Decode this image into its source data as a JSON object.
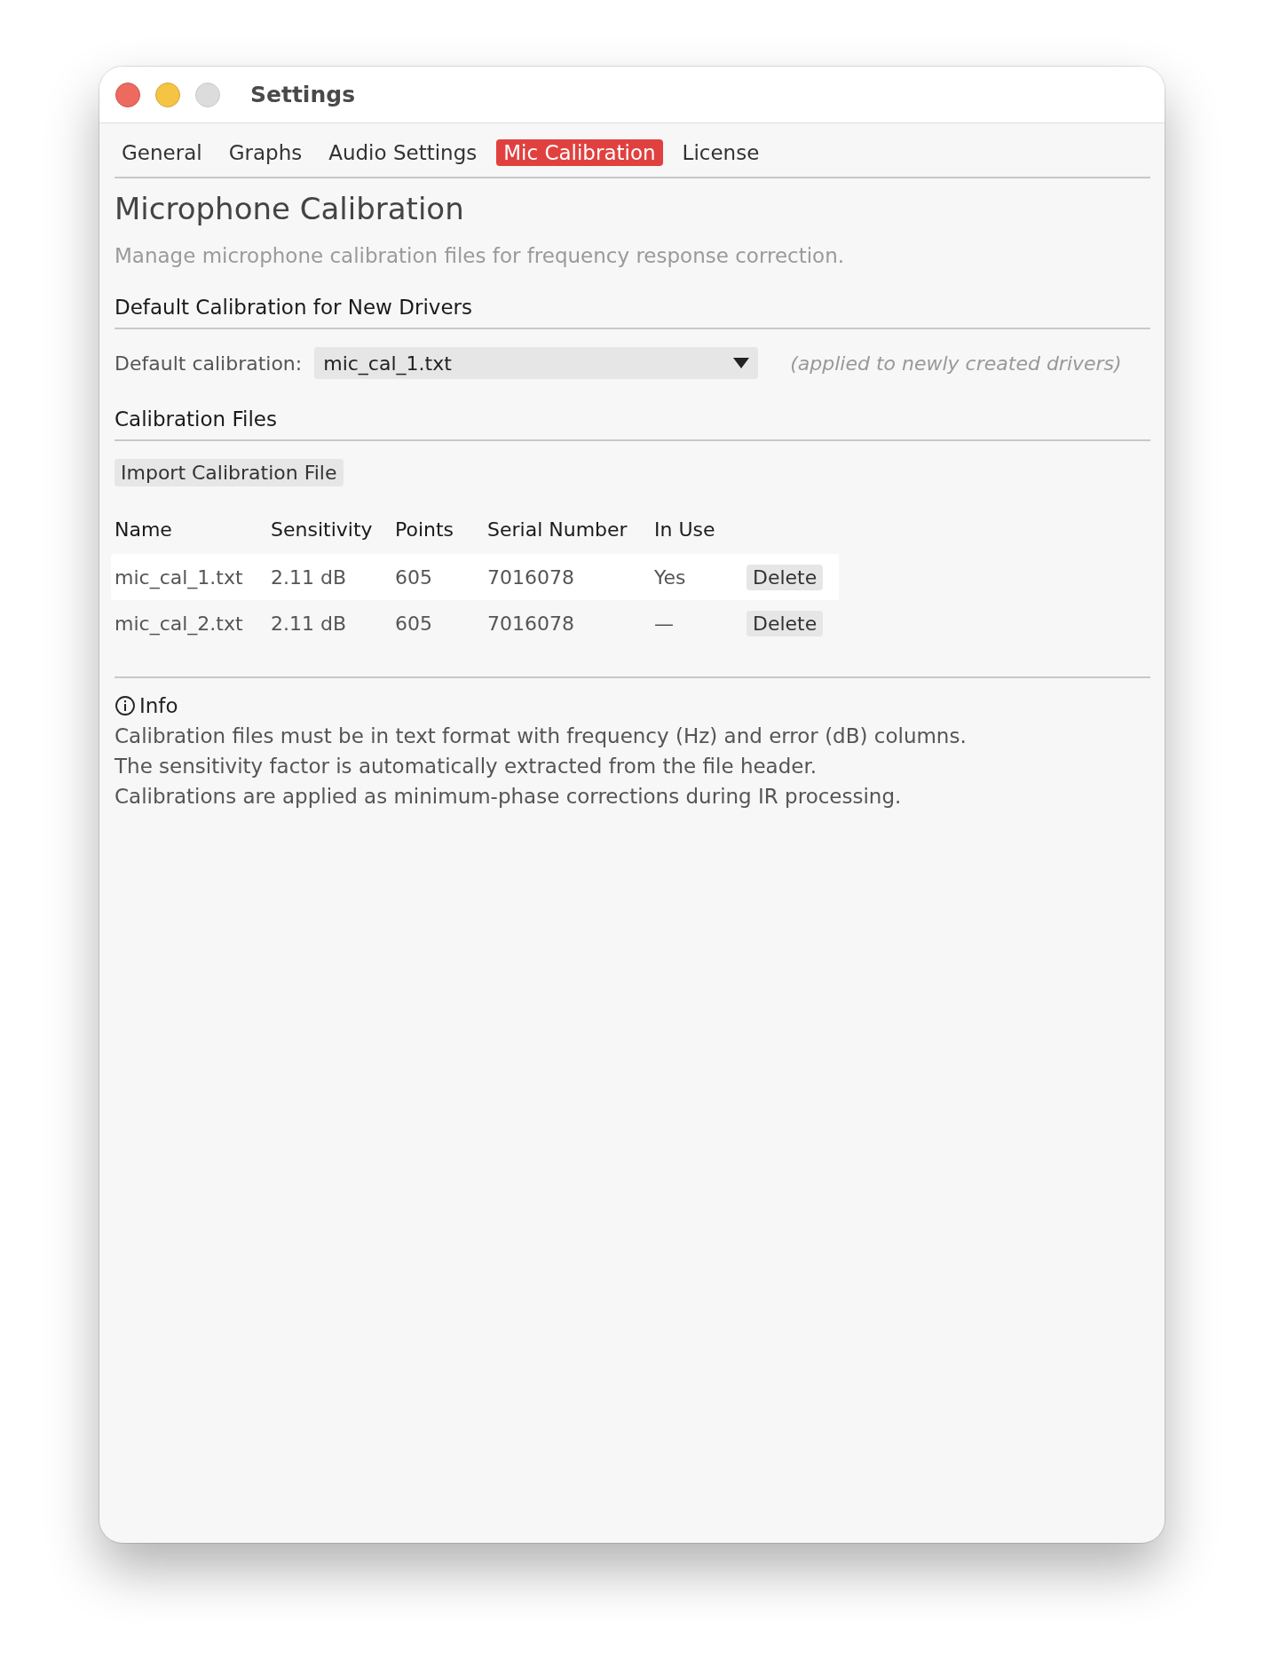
{
  "window": {
    "title": "Settings"
  },
  "tabs": [
    {
      "label": "General",
      "selected": false
    },
    {
      "label": "Graphs",
      "selected": false
    },
    {
      "label": "Audio Settings",
      "selected": false
    },
    {
      "label": "Mic Calibration",
      "selected": true
    },
    {
      "label": "License",
      "selected": false
    }
  ],
  "page": {
    "title": "Microphone Calibration",
    "subtitle": "Manage microphone calibration files for frequency response correction."
  },
  "default_section": {
    "heading": "Default Calibration for New Drivers",
    "label": "Default calibration:",
    "value": "mic_cal_1.txt",
    "note": "(applied to newly created drivers)"
  },
  "files_section": {
    "heading": "Calibration Files",
    "import_button": "Import Calibration File",
    "table": {
      "columns": [
        "Name",
        "Sensitivity",
        "Points",
        "Serial Number",
        "In Use"
      ],
      "rows": [
        {
          "cells": [
            "mic_cal_1.txt",
            "2.11 dB",
            "605",
            "7016078",
            "Yes"
          ],
          "action": "Delete"
        },
        {
          "cells": [
            "mic_cal_2.txt",
            "2.11 dB",
            "605",
            "7016078",
            "—"
          ],
          "action": "Delete"
        }
      ]
    }
  },
  "info": {
    "heading": "Info",
    "lines": [
      "Calibration files must be in text format with frequency (Hz) and error (dB) columns.",
      "The sensitivity factor is automatically extracted from the file header.",
      "Calibrations are applied as minimum-phase corrections during IR processing."
    ]
  }
}
